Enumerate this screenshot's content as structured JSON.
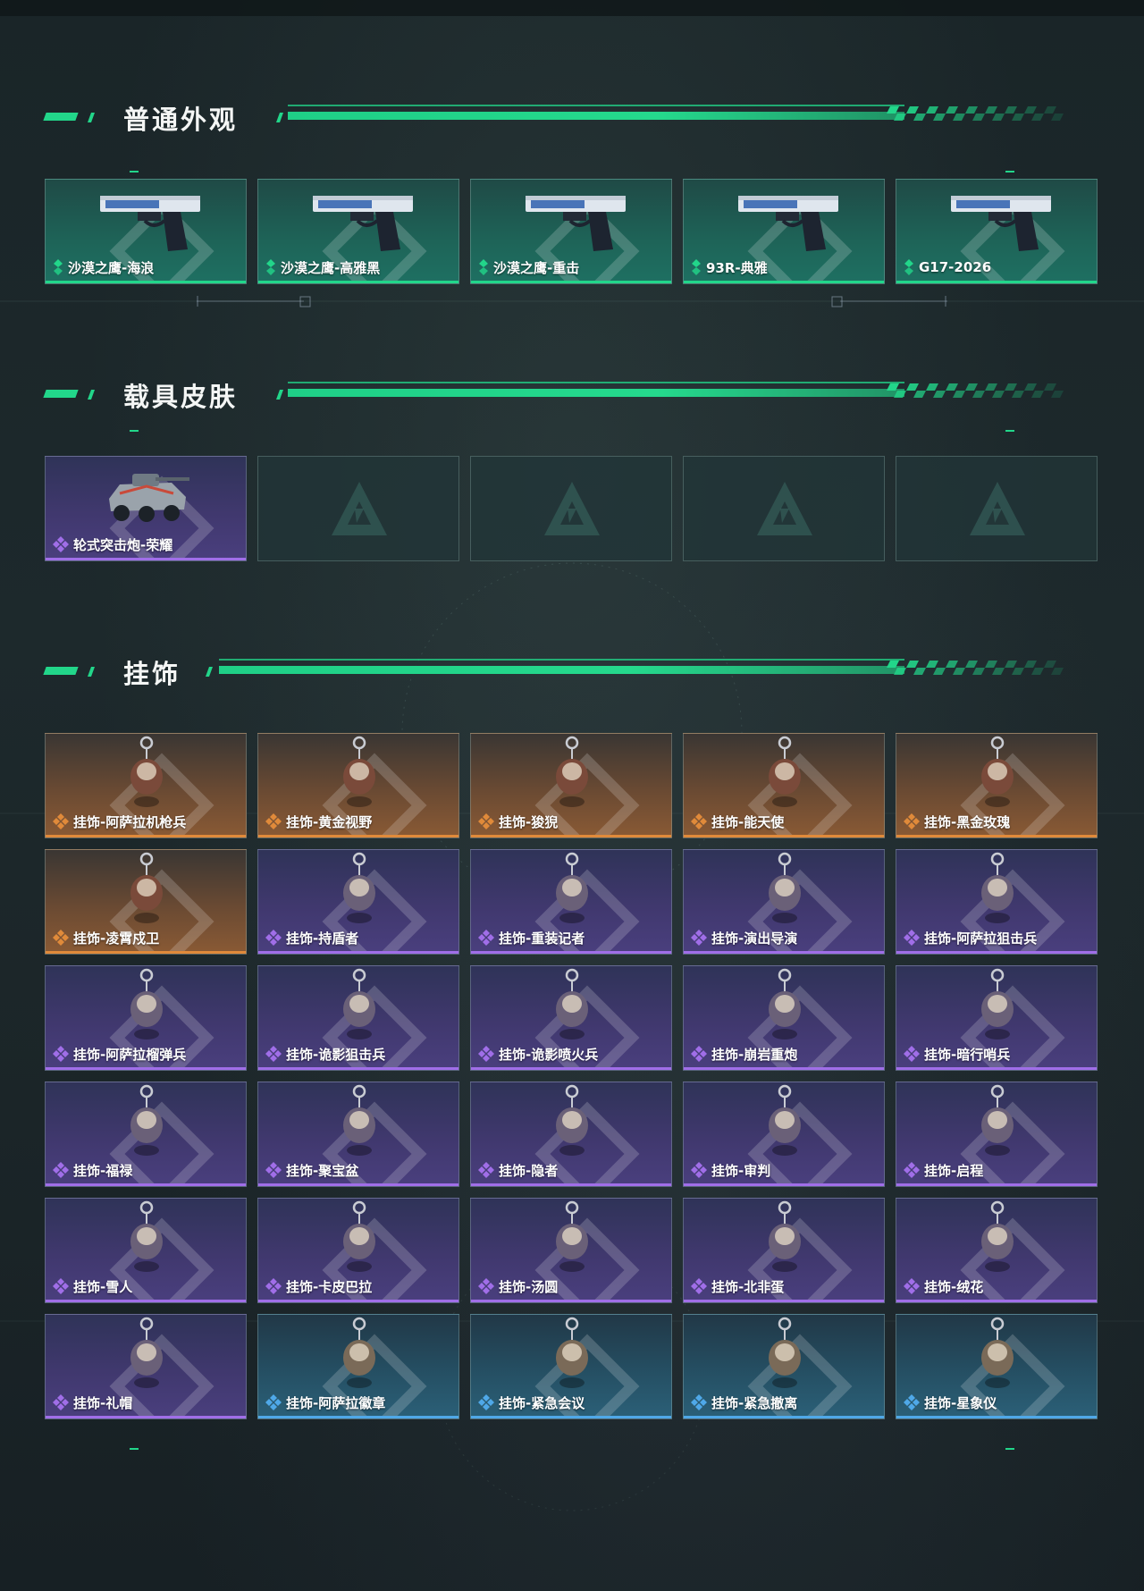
{
  "sections": {
    "skins": {
      "title": "普通外观"
    },
    "vehicles": {
      "title": "载具皮肤"
    },
    "charms": {
      "title": "挂饰"
    }
  },
  "colors": {
    "accent": "#22d68a",
    "rarity_green": "#22d68a",
    "rarity_purple": "#a06ee8",
    "rarity_orange": "#e08a3a",
    "rarity_blue": "#4fa8e8"
  },
  "skins": [
    {
      "name": "沙漠之鹰-海浪",
      "rarity": "green",
      "icon": "pistol-icon"
    },
    {
      "name": "沙漠之鹰-高雅黑",
      "rarity": "green",
      "icon": "pistol-icon"
    },
    {
      "name": "沙漠之鹰-重击",
      "rarity": "green",
      "icon": "pistol-icon"
    },
    {
      "name": "93R-典雅",
      "rarity": "green",
      "icon": "pistol-icon"
    },
    {
      "name": "G17-2026",
      "rarity": "green",
      "icon": "pistol-icon"
    }
  ],
  "vehicles": [
    {
      "name": "轮式突击炮-荣耀",
      "rarity": "purple",
      "icon": "armored-vehicle-icon"
    },
    {
      "name": "",
      "rarity": "empty",
      "icon": "delta-logo-icon"
    },
    {
      "name": "",
      "rarity": "empty",
      "icon": "delta-logo-icon"
    },
    {
      "name": "",
      "rarity": "empty",
      "icon": "delta-logo-icon"
    },
    {
      "name": "",
      "rarity": "empty",
      "icon": "delta-logo-icon"
    }
  ],
  "charms": [
    {
      "name": "挂饰-阿萨拉机枪兵",
      "rarity": "orange",
      "icon": "charm-icon"
    },
    {
      "name": "挂饰-黄金视野",
      "rarity": "orange",
      "icon": "charm-icon"
    },
    {
      "name": "挂饰-狻猊",
      "rarity": "orange",
      "icon": "charm-icon"
    },
    {
      "name": "挂饰-能天使",
      "rarity": "orange",
      "icon": "charm-icon"
    },
    {
      "name": "挂饰-黑金玫瑰",
      "rarity": "orange",
      "icon": "charm-icon"
    },
    {
      "name": "挂饰-凌霄戍卫",
      "rarity": "orange",
      "icon": "charm-icon"
    },
    {
      "name": "挂饰-持盾者",
      "rarity": "purple",
      "icon": "charm-icon"
    },
    {
      "name": "挂饰-重装记者",
      "rarity": "purple",
      "icon": "charm-icon"
    },
    {
      "name": "挂饰-演出导演",
      "rarity": "purple",
      "icon": "charm-icon"
    },
    {
      "name": "挂饰-阿萨拉狙击兵",
      "rarity": "purple",
      "icon": "charm-icon"
    },
    {
      "name": "挂饰-阿萨拉榴弹兵",
      "rarity": "purple",
      "icon": "charm-icon"
    },
    {
      "name": "挂饰-诡影狙击兵",
      "rarity": "purple",
      "icon": "charm-icon"
    },
    {
      "name": "挂饰-诡影喷火兵",
      "rarity": "purple",
      "icon": "charm-icon"
    },
    {
      "name": "挂饰-崩岩重炮",
      "rarity": "purple",
      "icon": "charm-icon"
    },
    {
      "name": "挂饰-暗行哨兵",
      "rarity": "purple",
      "icon": "charm-icon"
    },
    {
      "name": "挂饰-福禄",
      "rarity": "purple",
      "icon": "charm-icon"
    },
    {
      "name": "挂饰-聚宝盆",
      "rarity": "purple",
      "icon": "charm-icon"
    },
    {
      "name": "挂饰-隐者",
      "rarity": "purple",
      "icon": "charm-icon"
    },
    {
      "name": "挂饰-审判",
      "rarity": "purple",
      "icon": "charm-icon"
    },
    {
      "name": "挂饰-启程",
      "rarity": "purple",
      "icon": "charm-icon"
    },
    {
      "name": "挂饰-雪人",
      "rarity": "purple",
      "icon": "charm-icon"
    },
    {
      "name": "挂饰-卡皮巴拉",
      "rarity": "purple",
      "icon": "charm-icon"
    },
    {
      "name": "挂饰-汤圆",
      "rarity": "purple",
      "icon": "charm-icon"
    },
    {
      "name": "挂饰-北非蛋",
      "rarity": "purple",
      "icon": "charm-icon"
    },
    {
      "name": "挂饰-绒花",
      "rarity": "purple",
      "icon": "charm-icon"
    },
    {
      "name": "挂饰-礼帽",
      "rarity": "purple",
      "icon": "charm-icon"
    },
    {
      "name": "挂饰-阿萨拉徽章",
      "rarity": "blue",
      "icon": "charm-icon"
    },
    {
      "name": "挂饰-紧急会议",
      "rarity": "blue",
      "icon": "charm-icon"
    },
    {
      "name": "挂饰-紧急撤离",
      "rarity": "blue",
      "icon": "charm-icon"
    },
    {
      "name": "挂饰-星象仪",
      "rarity": "blue",
      "icon": "charm-icon"
    }
  ]
}
